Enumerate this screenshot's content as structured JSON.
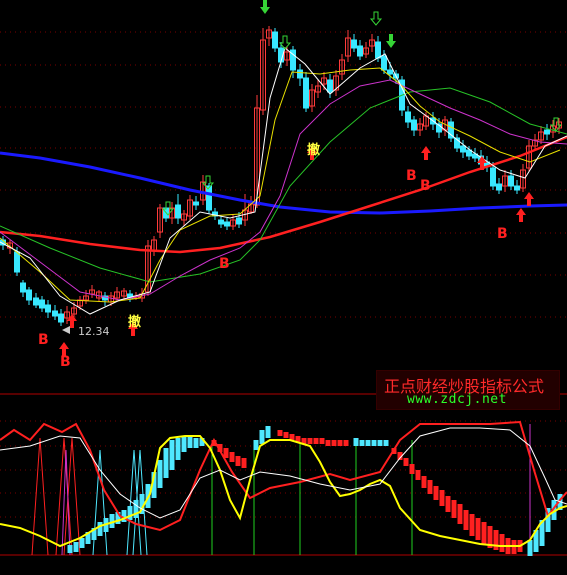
{
  "chart_data": [
    {
      "type": "candlestick",
      "panel": "main",
      "price_annotation": "12.34",
      "signal_labels": {
        "b": "B",
        "cancel": "撤"
      },
      "colors": {
        "up": "#ff3b3b",
        "down": "#38e8ff",
        "ma_long": "#1a1aff",
        "ma_mid": "#ff2020",
        "ma_fast": "#ffffff",
        "ma_yellow": "#e8e000",
        "ma_green": "#27c227",
        "ma_purple": "#cc33cc",
        "arrow_buy": "#ff2020",
        "arrow_sell": "#36d436"
      }
    },
    {
      "type": "line",
      "panel": "indicator",
      "colors": {
        "yellow": "#ffff00",
        "white": "#ffffff",
        "red": "#ff2020",
        "cyan_bars": "#4fe8ff",
        "red_bars": "#ff2020"
      }
    }
  ],
  "watermark": {
    "title": "正点财经炒股指标公式",
    "url": "www.zdcj.net"
  }
}
